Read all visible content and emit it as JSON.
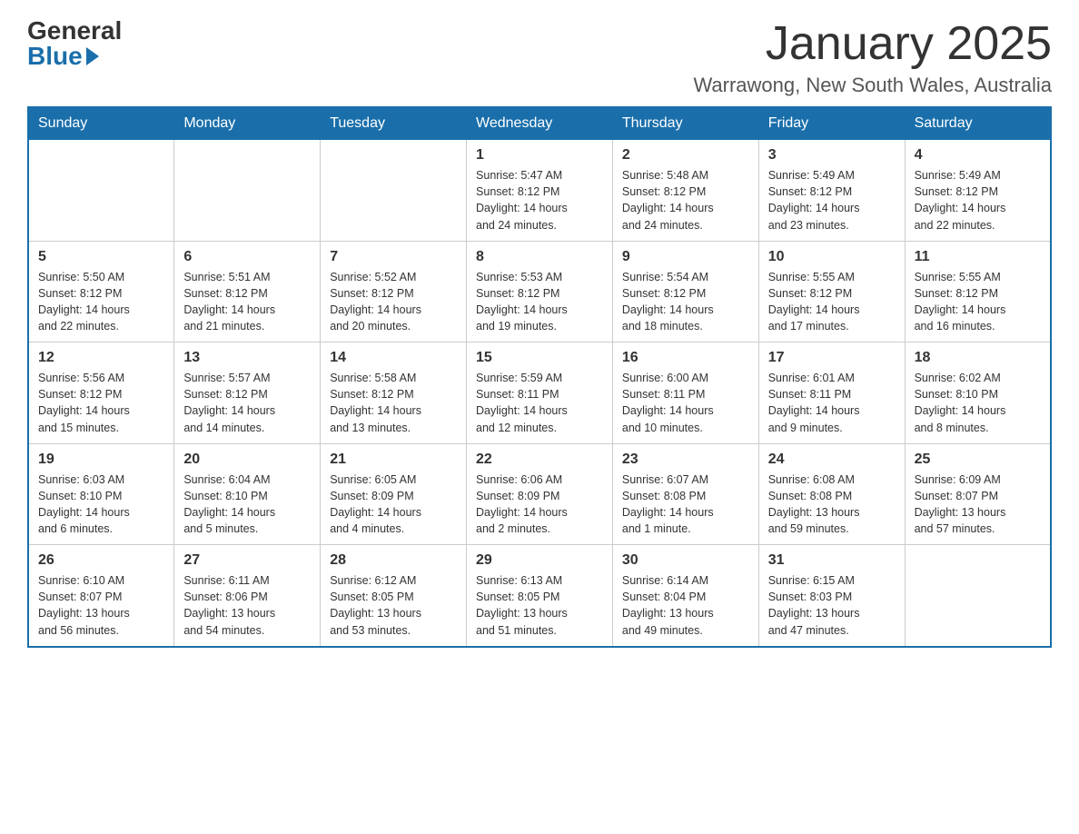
{
  "header": {
    "logo_line1": "General",
    "logo_line2": "Blue",
    "title": "January 2025",
    "subtitle": "Warrawong, New South Wales, Australia"
  },
  "calendar": {
    "days_of_week": [
      "Sunday",
      "Monday",
      "Tuesday",
      "Wednesday",
      "Thursday",
      "Friday",
      "Saturday"
    ],
    "weeks": [
      {
        "days": [
          {
            "number": "",
            "info": ""
          },
          {
            "number": "",
            "info": ""
          },
          {
            "number": "",
            "info": ""
          },
          {
            "number": "1",
            "info": "Sunrise: 5:47 AM\nSunset: 8:12 PM\nDaylight: 14 hours\nand 24 minutes."
          },
          {
            "number": "2",
            "info": "Sunrise: 5:48 AM\nSunset: 8:12 PM\nDaylight: 14 hours\nand 24 minutes."
          },
          {
            "number": "3",
            "info": "Sunrise: 5:49 AM\nSunset: 8:12 PM\nDaylight: 14 hours\nand 23 minutes."
          },
          {
            "number": "4",
            "info": "Sunrise: 5:49 AM\nSunset: 8:12 PM\nDaylight: 14 hours\nand 22 minutes."
          }
        ]
      },
      {
        "days": [
          {
            "number": "5",
            "info": "Sunrise: 5:50 AM\nSunset: 8:12 PM\nDaylight: 14 hours\nand 22 minutes."
          },
          {
            "number": "6",
            "info": "Sunrise: 5:51 AM\nSunset: 8:12 PM\nDaylight: 14 hours\nand 21 minutes."
          },
          {
            "number": "7",
            "info": "Sunrise: 5:52 AM\nSunset: 8:12 PM\nDaylight: 14 hours\nand 20 minutes."
          },
          {
            "number": "8",
            "info": "Sunrise: 5:53 AM\nSunset: 8:12 PM\nDaylight: 14 hours\nand 19 minutes."
          },
          {
            "number": "9",
            "info": "Sunrise: 5:54 AM\nSunset: 8:12 PM\nDaylight: 14 hours\nand 18 minutes."
          },
          {
            "number": "10",
            "info": "Sunrise: 5:55 AM\nSunset: 8:12 PM\nDaylight: 14 hours\nand 17 minutes."
          },
          {
            "number": "11",
            "info": "Sunrise: 5:55 AM\nSunset: 8:12 PM\nDaylight: 14 hours\nand 16 minutes."
          }
        ]
      },
      {
        "days": [
          {
            "number": "12",
            "info": "Sunrise: 5:56 AM\nSunset: 8:12 PM\nDaylight: 14 hours\nand 15 minutes."
          },
          {
            "number": "13",
            "info": "Sunrise: 5:57 AM\nSunset: 8:12 PM\nDaylight: 14 hours\nand 14 minutes."
          },
          {
            "number": "14",
            "info": "Sunrise: 5:58 AM\nSunset: 8:12 PM\nDaylight: 14 hours\nand 13 minutes."
          },
          {
            "number": "15",
            "info": "Sunrise: 5:59 AM\nSunset: 8:11 PM\nDaylight: 14 hours\nand 12 minutes."
          },
          {
            "number": "16",
            "info": "Sunrise: 6:00 AM\nSunset: 8:11 PM\nDaylight: 14 hours\nand 10 minutes."
          },
          {
            "number": "17",
            "info": "Sunrise: 6:01 AM\nSunset: 8:11 PM\nDaylight: 14 hours\nand 9 minutes."
          },
          {
            "number": "18",
            "info": "Sunrise: 6:02 AM\nSunset: 8:10 PM\nDaylight: 14 hours\nand 8 minutes."
          }
        ]
      },
      {
        "days": [
          {
            "number": "19",
            "info": "Sunrise: 6:03 AM\nSunset: 8:10 PM\nDaylight: 14 hours\nand 6 minutes."
          },
          {
            "number": "20",
            "info": "Sunrise: 6:04 AM\nSunset: 8:10 PM\nDaylight: 14 hours\nand 5 minutes."
          },
          {
            "number": "21",
            "info": "Sunrise: 6:05 AM\nSunset: 8:09 PM\nDaylight: 14 hours\nand 4 minutes."
          },
          {
            "number": "22",
            "info": "Sunrise: 6:06 AM\nSunset: 8:09 PM\nDaylight: 14 hours\nand 2 minutes."
          },
          {
            "number": "23",
            "info": "Sunrise: 6:07 AM\nSunset: 8:08 PM\nDaylight: 14 hours\nand 1 minute."
          },
          {
            "number": "24",
            "info": "Sunrise: 6:08 AM\nSunset: 8:08 PM\nDaylight: 13 hours\nand 59 minutes."
          },
          {
            "number": "25",
            "info": "Sunrise: 6:09 AM\nSunset: 8:07 PM\nDaylight: 13 hours\nand 57 minutes."
          }
        ]
      },
      {
        "days": [
          {
            "number": "26",
            "info": "Sunrise: 6:10 AM\nSunset: 8:07 PM\nDaylight: 13 hours\nand 56 minutes."
          },
          {
            "number": "27",
            "info": "Sunrise: 6:11 AM\nSunset: 8:06 PM\nDaylight: 13 hours\nand 54 minutes."
          },
          {
            "number": "28",
            "info": "Sunrise: 6:12 AM\nSunset: 8:05 PM\nDaylight: 13 hours\nand 53 minutes."
          },
          {
            "number": "29",
            "info": "Sunrise: 6:13 AM\nSunset: 8:05 PM\nDaylight: 13 hours\nand 51 minutes."
          },
          {
            "number": "30",
            "info": "Sunrise: 6:14 AM\nSunset: 8:04 PM\nDaylight: 13 hours\nand 49 minutes."
          },
          {
            "number": "31",
            "info": "Sunrise: 6:15 AM\nSunset: 8:03 PM\nDaylight: 13 hours\nand 47 minutes."
          },
          {
            "number": "",
            "info": ""
          }
        ]
      }
    ]
  }
}
